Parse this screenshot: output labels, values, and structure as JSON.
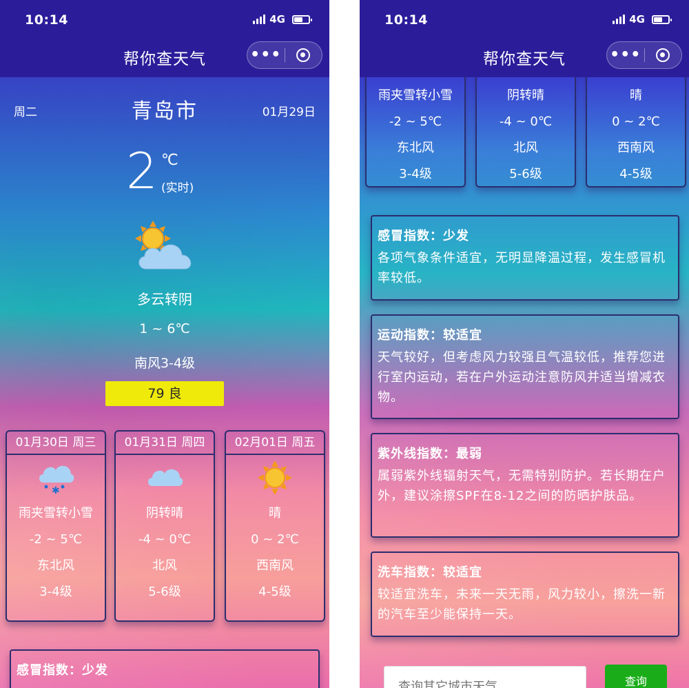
{
  "status": {
    "time": "10:14",
    "network": "4G"
  },
  "nav": {
    "title": "帮你查天气",
    "more": "•••"
  },
  "current": {
    "weekday": "周二",
    "city": "青岛市",
    "date": "01月29日",
    "temp": "2",
    "unit": "℃",
    "realtime": "(实时)",
    "condition": "多云转阴",
    "range": "1 ~ 6℃",
    "wind": "南风3-4级",
    "aqi": "79 良",
    "icon": "partly-cloudy-icon",
    "colors": {
      "aqi_bg": "#efea0a",
      "bar_bg": "#2b1d9a"
    }
  },
  "forecast": [
    {
      "header": "01月30日 周三",
      "condition": "雨夹雪转小雪",
      "range": "-2 ~ 5℃",
      "wind_dir": "东北风",
      "wind_level": "3-4级",
      "icon": "sleet-icon"
    },
    {
      "header": "01月31日 周四",
      "condition": "阴转晴",
      "range": "-4 ~ 0℃",
      "wind_dir": "北风",
      "wind_level": "5-6级",
      "icon": "cloud-icon"
    },
    {
      "header": "02月01日 周五",
      "condition": "晴",
      "range": "0 ~ 2℃",
      "wind_dir": "西南风",
      "wind_level": "4-5级",
      "icon": "sun-icon"
    }
  ],
  "indices": [
    {
      "title": "感冒指数：少发",
      "text": "各项气象条件适宜，无明显降温过程，发生感冒机率较低。"
    },
    {
      "title": "运动指数：较适宜",
      "text": "天气较好，但考虑风力较强且气温较低，推荐您进行室内运动，若在户外运动注意防风并适当增减衣物。"
    },
    {
      "title": "紫外线指数：最弱",
      "text": "属弱紫外线辐射天气，无需特别防护。若长期在户外，建议涂擦SPF在8-12之间的防晒护肤品。"
    },
    {
      "title": "洗车指数：较适宜",
      "text": "较适宜洗车，未来一天无雨，风力较小，擦洗一新的汽车至少能保持一天。"
    }
  ],
  "search": {
    "placeholder": "查询其它城市天气",
    "button": "查询"
  }
}
